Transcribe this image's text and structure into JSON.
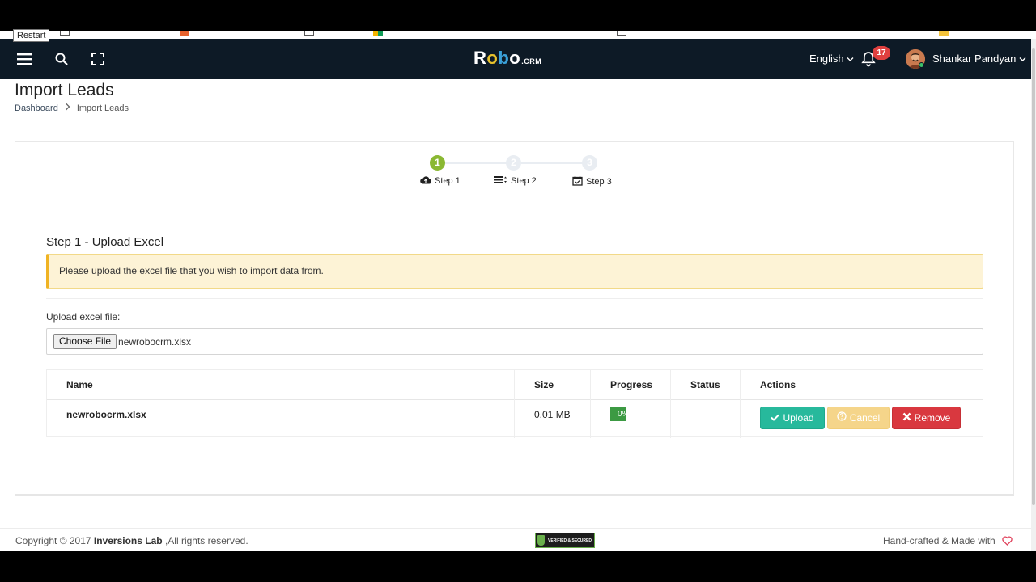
{
  "browser": {
    "tooltip": "Restart"
  },
  "navbar": {
    "logo_text": "Robo",
    "logo_suffix": ".CRM",
    "language": "English",
    "notification_count": "17",
    "user_name": "Shankar Pandyan"
  },
  "page": {
    "title": "Import Leads",
    "breadcrumb": [
      "Dashboard",
      "Import Leads"
    ]
  },
  "stepper": {
    "steps": [
      {
        "number": "1",
        "label": "Step 1",
        "icon": "cloud-upload-icon",
        "active": true
      },
      {
        "number": "2",
        "label": "Step 2",
        "icon": "list-sort-icon",
        "active": false
      },
      {
        "number": "3",
        "label": "Step 3",
        "icon": "calendar-check-icon",
        "active": false
      }
    ]
  },
  "upload": {
    "section_title": "Step 1 - Upload Excel",
    "alert_text": "Please upload the excel file that you wish to import data from.",
    "field_label": "Upload excel file:",
    "choose_button": "Choose File",
    "file_name": "newrobocrm.xlsx"
  },
  "table": {
    "headers": [
      "Name",
      "Size",
      "Progress",
      "Status",
      "Actions"
    ],
    "rows": [
      {
        "name": "newrobocrm.xlsx",
        "size": "0.01 MB",
        "progress_text": "0%",
        "progress": 0,
        "status": ""
      }
    ],
    "actions": {
      "upload": "Upload",
      "cancel": "Cancel",
      "remove": "Remove"
    }
  },
  "footer": {
    "copyright_prefix": "Copyright © 2017",
    "company": "Inversions Lab",
    "copyright_suffix": ",All rights reserved.",
    "seal_text": "VERIFIED & SECURED",
    "right_text": "Hand-crafted & Made with"
  },
  "colors": {
    "navbar": "#0d1a26",
    "step_active": "#8ab832",
    "step_inactive": "#e9edf2",
    "alert_border": "#f0b323",
    "upload_button": "#27b99c",
    "cancel_button": "#f5d58a",
    "remove_button": "#d9383f",
    "progress": "#3c9a43",
    "heart": "#e0405a"
  }
}
